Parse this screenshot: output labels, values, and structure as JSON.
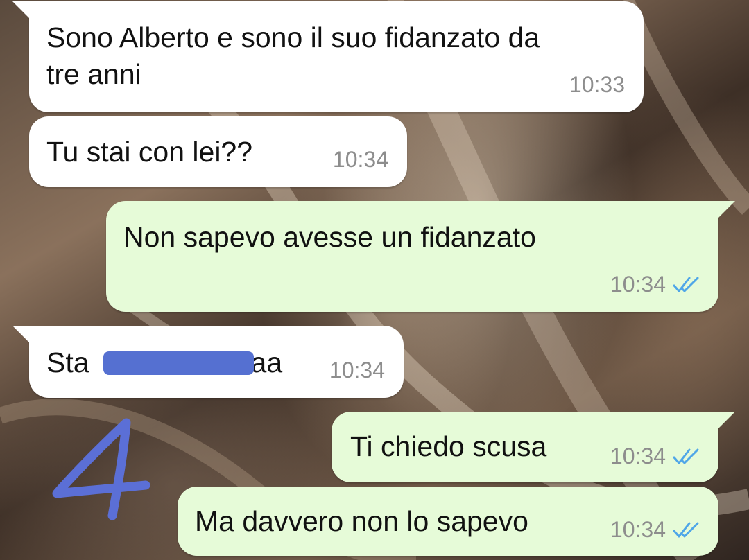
{
  "chat": {
    "messages": [
      {
        "direction": "incoming",
        "text_line1": "Sono Alberto e sono il suo fidanzato da",
        "text_line2": "tre anni",
        "time": "10:33"
      },
      {
        "direction": "incoming",
        "text": "Tu stai con lei??",
        "time": "10:34"
      },
      {
        "direction": "outgoing",
        "text": "Non sapevo avesse un fidanzato",
        "time": "10:34",
        "status_icon": "double-check-read-icon"
      },
      {
        "direction": "incoming",
        "text_prefix": "Sta",
        "text_suffix": "aa",
        "time": "10:34",
        "redacted": true
      },
      {
        "direction": "outgoing",
        "text": "Ti chiedo scusa",
        "time": "10:34",
        "status_icon": "double-check-read-icon"
      },
      {
        "direction": "outgoing",
        "text": "Ma davvero non lo sapevo",
        "time": "10:34",
        "status_icon": "double-check-read-icon"
      }
    ]
  },
  "annotation": {
    "mark": "4",
    "color": "#5b6fd6"
  },
  "colors": {
    "incoming_bubble": "#ffffff",
    "outgoing_bubble": "#e6fbd8",
    "read_ticks": "#4fa6e8",
    "redaction": "#5570d1",
    "timestamp": "#8d8d8d"
  }
}
